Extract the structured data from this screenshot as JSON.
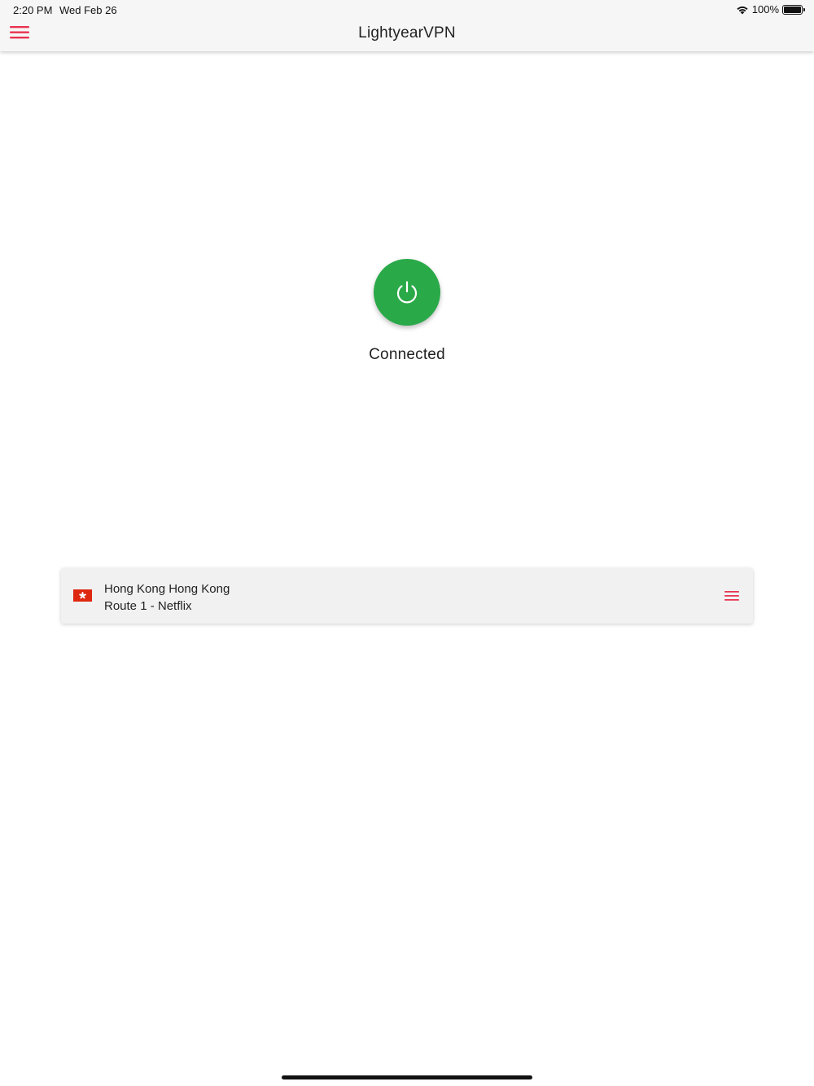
{
  "status_bar": {
    "time": "2:20 PM",
    "date": "Wed Feb 26",
    "battery_percent": "100%"
  },
  "header": {
    "title": "LightyearVPN",
    "menu_icon": "hamburger-menu-icon"
  },
  "connection": {
    "status": "Connected",
    "power_icon": "power-icon",
    "color": "#2aa948"
  },
  "server": {
    "name": "Hong Kong Hong Kong",
    "route": "Route 1 - Netflix",
    "flag_icon": "hong-kong-flag-icon",
    "menu_icon": "list-menu-icon"
  },
  "colors": {
    "accent": "#e8334f",
    "connected_green": "#2aa948"
  }
}
